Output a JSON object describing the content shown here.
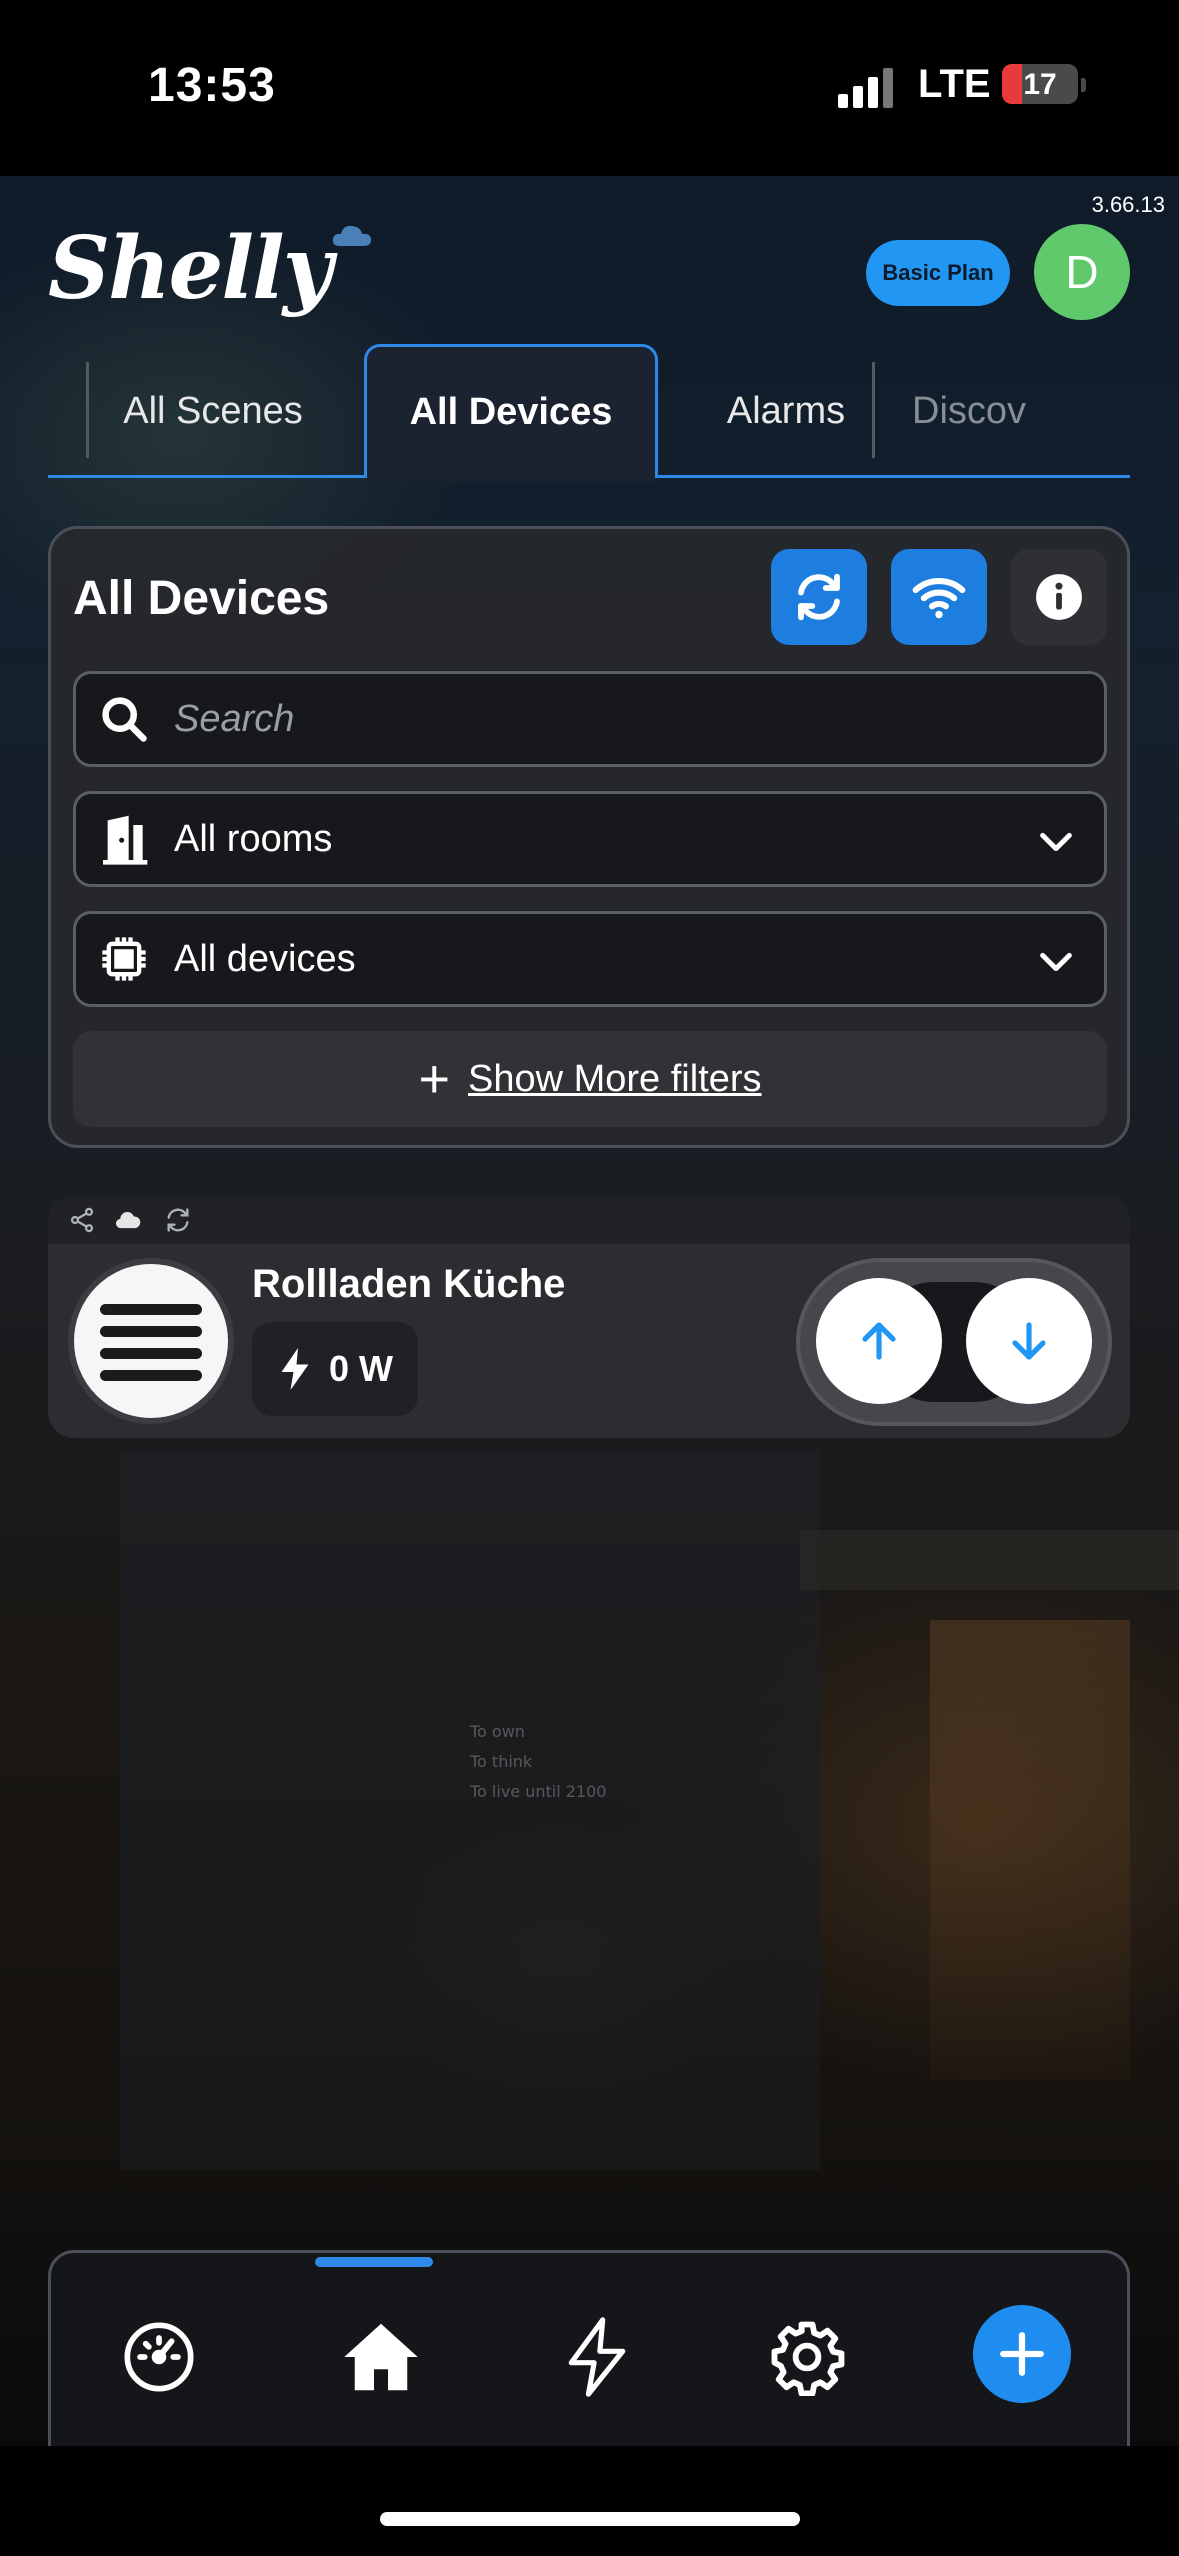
{
  "status_bar": {
    "time": "13:53",
    "network": "LTE",
    "battery": "17",
    "battery_color": "#e83a3a"
  },
  "app": {
    "version": "3.66.13",
    "logo": "Shelly",
    "plan_label": "Basic Plan",
    "avatar_initial": "D",
    "accent_color": "#2f89e8"
  },
  "tabs": [
    {
      "label": "All Scenes",
      "active": false
    },
    {
      "label": "All Devices",
      "active": true
    },
    {
      "label": "Alarms",
      "active": false
    },
    {
      "label": "Discov",
      "active": false
    }
  ],
  "filters": {
    "title": "All Devices",
    "refresh_icon": "refresh-icon",
    "wifi_icon": "wifi-icon",
    "info_icon": "info-icon",
    "search_placeholder": "Search",
    "rooms_value": "All rooms",
    "devices_value": "All devices",
    "more_filters_label": "Show More filters"
  },
  "devices": [
    {
      "name": "Rollladen Küche",
      "power": "0 W",
      "meta_icons": [
        "share-icon",
        "cloud-icon",
        "sync-icon"
      ],
      "controls": [
        "up-arrow-icon",
        "down-arrow-icon"
      ]
    }
  ],
  "background": {
    "sign_lines": [
      "To own",
      "To think",
      "To live until 2100"
    ]
  },
  "bottom_nav": [
    {
      "icon": "dashboard-gauge-icon",
      "active": false
    },
    {
      "icon": "home-icon",
      "active": true
    },
    {
      "icon": "energy-bolt-icon",
      "active": false
    },
    {
      "icon": "settings-gear-icon",
      "active": false
    },
    {
      "icon": "add-icon",
      "active": false
    }
  ]
}
